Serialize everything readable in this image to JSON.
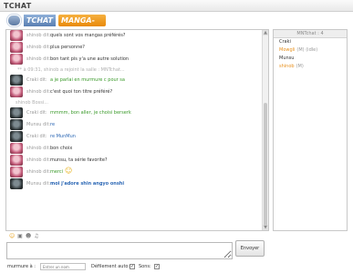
{
  "app": {
    "title": "TCHAT"
  },
  "logo": {
    "tchat_text": "TCHAT",
    "brand_text": "MANGA-NEWS"
  },
  "colors": {
    "green": "#3a9a2a",
    "blue": "#2d68b5",
    "orange": "#e8901c",
    "gray": "#9a9a9a",
    "dark": "#333333",
    "system": "#b0b0b0"
  },
  "messages": [
    {
      "who": "shinob dit:",
      "text": "quels sont vos mangas préférés?",
      "avatar": "pink",
      "color": "#333333"
    },
    {
      "who": "shinob dit:",
      "text": "plus personne?",
      "avatar": "pink",
      "color": "#333333"
    },
    {
      "who": "shinob dit:",
      "text": "bon tant pis y'a une autre solution",
      "avatar": "pink",
      "color": "#333333"
    },
    {
      "system": "** à 09:31, shinob a rejoint la salle : MNTchat..."
    },
    {
      "who": "Craki dit:",
      "text": "a je parlai en murmure c pour sa",
      "avatar": "dark",
      "color": "#3a9a2a"
    },
    {
      "who": "shinob dit:",
      "text": "c'est quoi ton titre préféré?",
      "avatar": "pink",
      "color": "#333333"
    },
    {
      "system": "shinob Bossi...",
      "indent": true
    },
    {
      "who": "Craki dit:",
      "text": "mmmm, bon aller, je choisi berserk",
      "avatar": "dark",
      "color": "#3a9a2a"
    },
    {
      "who": "Munsu dit:",
      "text": "re",
      "avatar": "dark",
      "color": "#2d68b5"
    },
    {
      "who": "Craki dit:",
      "text": "re MunMun",
      "avatar": "dark",
      "color": "#2d68b5"
    },
    {
      "who": "shinob dit:",
      "text": "bon choix",
      "avatar": "pink",
      "color": "#333333"
    },
    {
      "who": "shinob dit:",
      "text": "munsu, ta série favorite?",
      "avatar": "pink",
      "color": "#333333"
    },
    {
      "who": "shinob dit:",
      "text": "merci",
      "avatar": "pink",
      "color": "#3a9a2a",
      "emoticon": true
    },
    {
      "who": "Munsu dit:",
      "text": "moi j'adore shin angyo onshi",
      "avatar": "dark",
      "color": "#2d68b5",
      "bold": true
    }
  ],
  "users_panel": {
    "header": "MNTchat : 4",
    "users": [
      {
        "name": "Craki",
        "status": "",
        "color": "#333333"
      },
      {
        "name": "Mowgli",
        "status": "(M) (idle)",
        "color": "#e8901c"
      },
      {
        "name": "Munsu",
        "status": "",
        "color": "#333333"
      },
      {
        "name": "shinob",
        "status": "(M)",
        "color": "#e8901c"
      }
    ]
  },
  "composer": {
    "send_label": "Envoyer",
    "whisper_label": "murmure à :",
    "whisper_placeholder": "Entrer un nom",
    "autoscroll_label": "Défilement auto:",
    "sound_label": "Sons:"
  },
  "toolbar": {
    "icons": [
      "smiley-icon",
      "color-picker-icon",
      "user-icon",
      "sound-icon"
    ]
  }
}
